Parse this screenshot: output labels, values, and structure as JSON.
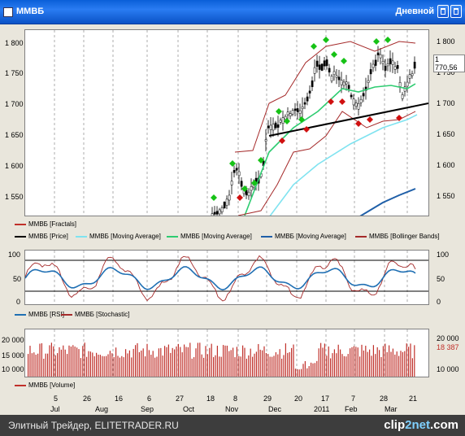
{
  "window": {
    "title": "ММВБ",
    "timeframe": "Дневной"
  },
  "price_panel": {
    "y_ticks_left": [
      "1 800",
      "1 750",
      "1 700",
      "1 650",
      "1 600",
      "1 550"
    ],
    "y_ticks_right": [
      "1 800",
      "1 750",
      "1 700",
      "1 650",
      "1 600",
      "1 550"
    ],
    "last_price": "1 770,56"
  },
  "legend_row1": {
    "fractals": "ММВБ [Fractals]"
  },
  "legend_row2": {
    "price": "ММВБ [Price]",
    "ma1": "ММВБ [Moving Average]",
    "ma2": "ММВБ [Moving Average]",
    "ma3": "ММВБ [Moving Average]",
    "bb": "ММВБ [Bollinger Bands]"
  },
  "osc_panel": {
    "y_ticks_left": [
      "100",
      "50",
      "0"
    ],
    "y_ticks_right": [
      "100",
      "50",
      "0"
    ],
    "legend_rsi": "ММВБ [RSI]",
    "legend_stoch": "ММВБ [Stochastic]"
  },
  "volume_panel": {
    "y_ticks_left": [
      "20 000",
      "15 000",
      "10 000"
    ],
    "y_ticks_right": [
      "20 000",
      "18 387",
      "10 000"
    ],
    "legend": "ММВБ [Volume]"
  },
  "x_axis": {
    "days": [
      "5",
      "26",
      "16",
      "6",
      "27",
      "18",
      "8",
      "29",
      "20",
      "17",
      "7",
      "28",
      "21"
    ],
    "months": [
      "Jul",
      "Aug",
      "Sep",
      "Oct",
      "Nov",
      "Dec",
      "2011",
      "Feb",
      "Mar"
    ]
  },
  "footer": {
    "caption": "Элитный Трейдер, ELITETRADER.RU",
    "brand_a": "clip",
    "brand_b": "2net",
    "brand_c": ".com"
  },
  "colors": {
    "candles": "#000000",
    "bollinger": "#a52a2a",
    "ma_fast": "#2ecc71",
    "ma_mid": "#7fe3f0",
    "ma_slow": "#1f5fa8",
    "fractal_up": "#16c216",
    "fractal_down": "#d01010",
    "rsi": "#1f6fb3",
    "stochastic": "#a52a2a",
    "volume": "#c0302a"
  }
}
